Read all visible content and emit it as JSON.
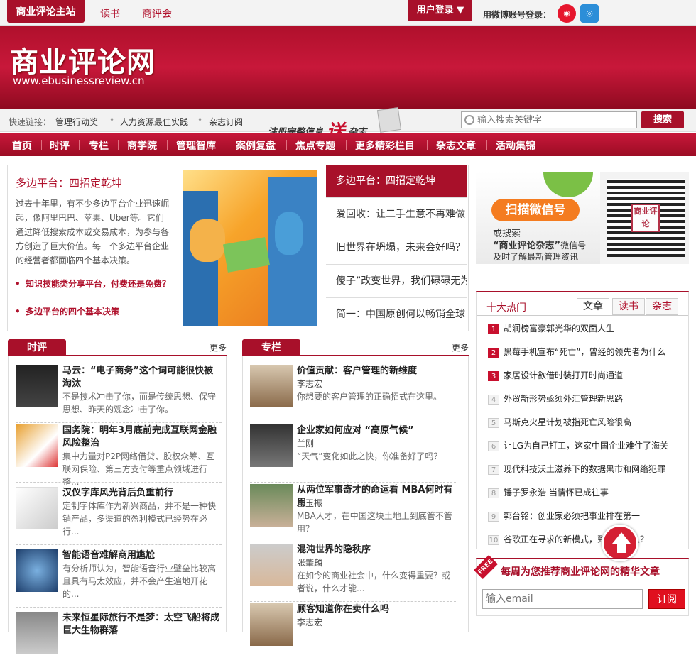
{
  "topbar": {
    "site_main": "商业评论主站",
    "link_books": "读书",
    "link_club": "商评会",
    "login": "用户登录 ▼",
    "weibo_label": "用微博账号登录："
  },
  "banner": {
    "logo": "商业评论网",
    "url": "www.ebusinessreview.cn"
  },
  "quickbar": {
    "label": "快速链接：",
    "links": [
      "管理行动奖",
      "人力资源最佳实践",
      "杂志订阅"
    ],
    "promo_pre": "注册完整信息",
    "promo_big": "送",
    "promo_post": "杂志"
  },
  "search": {
    "placeholder": "输入搜索关键字",
    "button": "搜索"
  },
  "nav": [
    "首页",
    "时评",
    "专栏",
    "商学院",
    "管理智库",
    "案例复盘",
    "焦点专题",
    "更多精彩栏目",
    "杂志文章",
    "活动集锦"
  ],
  "feature": {
    "title": "多边平台：四招定乾坤",
    "desc": "过去十年里，有不少多边平台企业迅速崛起，像阿里巴巴、苹果、Uber等。它们通过降低搜索成本或交易成本，为参与各方创造了巨大价值。每一个多边平台企业的经营者都面临四个基本决策。",
    "links": [
      "知识技能类分享平台，付费还是免费？",
      "多边平台的四个基本决策"
    ]
  },
  "feature_tabs": [
    "多边平台：四招定乾坤",
    "爱回收：让二手生意不再难做",
    "旧世界在坍塌，未来会好吗？",
    "傻子”改变世界，我们碌碌无为",
    "简一：中国原创何以畅销全球"
  ],
  "wechat": {
    "scan": "扫描微信号",
    "line1": "或搜索",
    "line2_bold": "“商业评论杂志”",
    "line2_rest": "微信号",
    "line3": "及时了解最新管理资讯",
    "qr_text": "商业评论"
  },
  "shiping": {
    "header": "时评",
    "more": "更多",
    "items": [
      {
        "title": "马云：“电子商务”这个词可能很快被淘汰",
        "summary": "不是技术冲击了你，而是传统思想、保守思想、昨天的观念冲击了你。"
      },
      {
        "title": "国务院：明年3月底前完成互联网金融风险整治",
        "summary": "集中力量对P2P网络借贷、股权众筹、互联网保险、第三方支付等重点领域进行整..."
      },
      {
        "title": "汉仪字库风光背后负重前行",
        "summary": "定制字体库作为新兴商品，并不是一种快销产品，多渠道的盈利模式已经势在必行..."
      },
      {
        "title": "智能语音难解商用尴尬",
        "summary": "有分析师认为，智能语音行业壁垒比较高且具有马太效应，并不会产生遍地开花的..."
      },
      {
        "title": "未来恒星际旅行不是梦：太空飞船将成巨大生物群落",
        "summary": ""
      }
    ]
  },
  "zhuanlan": {
    "header": "专栏",
    "more": "更多",
    "items": [
      {
        "title": "价值贡献：客户管理的新维度",
        "author": "李志宏",
        "summary": "你想要的客户管理的正确招式在这里。"
      },
      {
        "title": "企业家如何应对 “高原气候”",
        "author": "兰刚",
        "summary": "“天气”变化如此之快，你准备好了吗？"
      },
      {
        "title": "从两位军事奇才的命运看 MBA何时有用",
        "author": "宫玉振",
        "summary": "MBA人才，在中国这块土地上到底管不管用？"
      },
      {
        "title": "混沌世界的隐秩序",
        "author": "张肇麟",
        "summary": "在如今的商业社会中，什么变得重要？或者说，什么才能..."
      },
      {
        "title": "顾客知道你在卖什么吗",
        "author": "李志宏",
        "summary": ""
      }
    ]
  },
  "hot": {
    "title": "十大热门",
    "tabs": [
      "文章",
      "读书",
      "杂志"
    ],
    "items": [
      "胡润榜富豪郭光华的双面人生",
      "黑莓手机宣布“死亡”，曾经的领先者为什么",
      "家居设计欲借时装打开时尚通道",
      "外贸新形势亟须外汇管理新思路",
      "马斯克火星计划被指死亡风险很高",
      "让LG为自己打工，这家中国企业难住了海关",
      "现代科技沃土滋养下的数据黑市和网络犯罪",
      "锤子罗永浩 当情怀已成往事",
      "郭台铭：创业家必须把事业排在第一",
      "谷歌正在寻求的新模式，到底是什么？"
    ]
  },
  "subscribe": {
    "badge": "FREE",
    "title": "每周为您推荐商业评论网的精华文章",
    "placeholder": "输入email",
    "button": "订阅"
  },
  "colors": {
    "brand": "#a8102a",
    "accent": "#c8102e"
  }
}
